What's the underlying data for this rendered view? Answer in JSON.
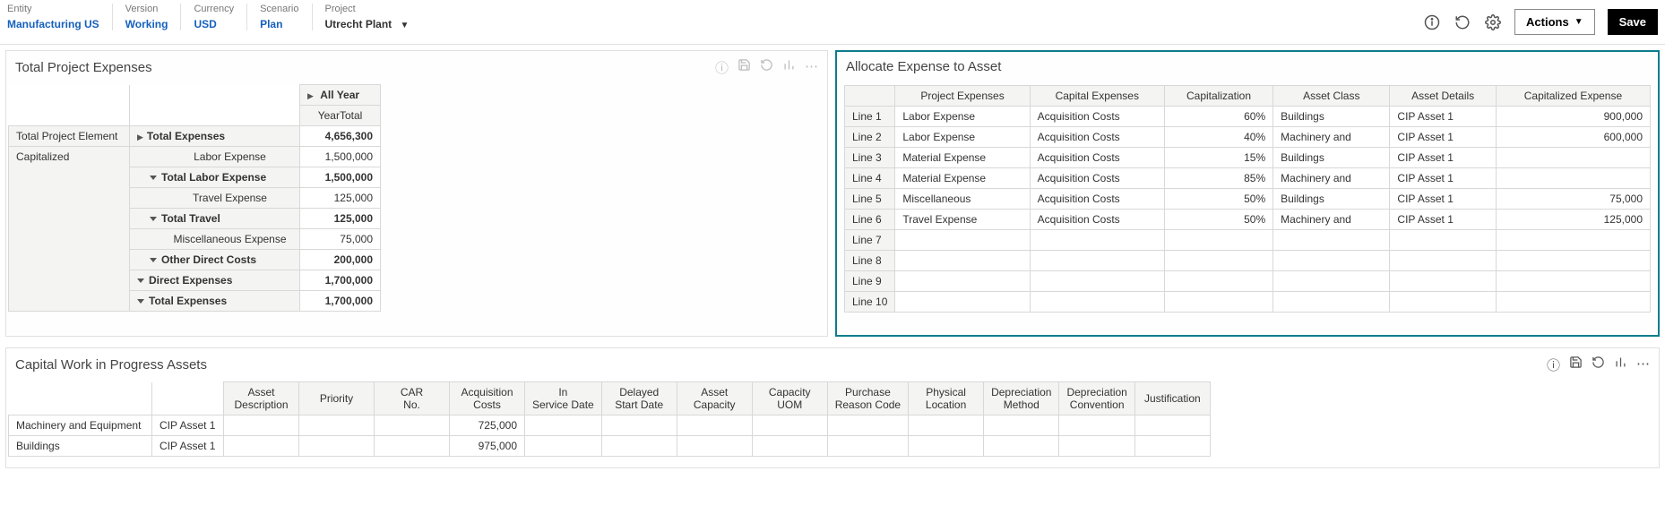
{
  "pov": {
    "items": [
      {
        "label": "Entity",
        "value": "Manufacturing US",
        "link": true
      },
      {
        "label": "Version",
        "value": "Working",
        "link": true
      },
      {
        "label": "Currency",
        "value": "USD",
        "link": true
      },
      {
        "label": "Scenario",
        "value": "Plan",
        "link": true
      },
      {
        "label": "Project",
        "value": "Utrecht Plant",
        "link": false,
        "dropdown": true
      }
    ],
    "actions_label": "Actions",
    "save_label": "Save"
  },
  "left_panel": {
    "title": "Total Project Expenses",
    "col_header_top": "All Year",
    "col_header_sub": "YearTotal",
    "row_header_1": "Total Project Element",
    "row_header_2": "Capitalized",
    "rows": [
      {
        "label": "Total Expenses",
        "value": "4,656,300",
        "bold": true,
        "tri": "r",
        "indent": 0
      },
      {
        "label": "Labor Expense",
        "value": "1,500,000",
        "bold": false,
        "tri": "",
        "indent": 2
      },
      {
        "label": "Total Labor Expense",
        "value": "1,500,000",
        "bold": true,
        "tri": "d",
        "indent": 1
      },
      {
        "label": "Travel Expense",
        "value": "125,000",
        "bold": false,
        "tri": "",
        "indent": 2
      },
      {
        "label": "Total Travel",
        "value": "125,000",
        "bold": true,
        "tri": "d",
        "indent": 1
      },
      {
        "label": "Miscellaneous Expense",
        "value": "75,000",
        "bold": false,
        "tri": "",
        "indent": 2
      },
      {
        "label": "Other Direct Costs",
        "value": "200,000",
        "bold": true,
        "tri": "d",
        "indent": 1
      },
      {
        "label": "Direct Expenses",
        "value": "1,700,000",
        "bold": true,
        "tri": "d",
        "indent": 0
      },
      {
        "label": "Total Expenses",
        "value": "1,700,000",
        "bold": true,
        "tri": "d",
        "indent": 0
      }
    ]
  },
  "right_panel": {
    "title": "Allocate Expense to Asset",
    "columns": [
      "Project Expenses",
      "Capital Expenses",
      "Capitalization",
      "Asset Class",
      "Asset Details",
      "Capitalized Expense"
    ],
    "row_labels": [
      "Line 1",
      "Line 2",
      "Line 3",
      "Line 4",
      "Line 5",
      "Line 6",
      "Line 7",
      "Line 8",
      "Line 9",
      "Line 10"
    ],
    "rows": [
      {
        "pe": "Labor Expense",
        "ce": "Acquisition Costs",
        "cap": "60%",
        "ac": "Buildings",
        "ad": "CIP Asset 1",
        "amt": "900,000"
      },
      {
        "pe": "Labor Expense",
        "ce": "Acquisition Costs",
        "cap": "40%",
        "ac": "Machinery and",
        "ad": "CIP Asset 1",
        "amt": "600,000"
      },
      {
        "pe": "Material Expense",
        "ce": "Acquisition Costs",
        "cap": "15%",
        "ac": "Buildings",
        "ad": "CIP Asset 1",
        "amt": ""
      },
      {
        "pe": "Material Expense",
        "ce": "Acquisition Costs",
        "cap": "85%",
        "ac": "Machinery and",
        "ad": "CIP Asset 1",
        "amt": ""
      },
      {
        "pe": "Miscellaneous",
        "ce": "Acquisition Costs",
        "cap": "50%",
        "ac": "Buildings",
        "ad": "CIP Asset 1",
        "amt": "75,000"
      },
      {
        "pe": "Travel Expense",
        "ce": "Acquisition Costs",
        "cap": "50%",
        "ac": "Machinery and",
        "ad": "CIP Asset 1",
        "amt": "125,000"
      },
      {
        "pe": "",
        "ce": "",
        "cap": "",
        "ac": "",
        "ad": "",
        "amt": ""
      },
      {
        "pe": "",
        "ce": "",
        "cap": "",
        "ac": "",
        "ad": "",
        "amt": ""
      },
      {
        "pe": "",
        "ce": "",
        "cap": "",
        "ac": "",
        "ad": "",
        "amt": ""
      },
      {
        "pe": "",
        "ce": "",
        "cap": "",
        "ac": "",
        "ad": "",
        "amt": ""
      }
    ]
  },
  "cwip_panel": {
    "title": "Capital Work in Progress Assets",
    "columns": [
      "Asset Description",
      "Priority",
      "CAR No.",
      "Acquisition Costs",
      "In Service Date",
      "Delayed Start Date",
      "Asset Capacity",
      "Capacity UOM",
      "Purchase Reason Code",
      "Physical Location",
      "Depreciation Method",
      "Depreciation Convention",
      "Justification"
    ],
    "rows": [
      {
        "h1": "Machinery and Equipment",
        "h2": "CIP Asset 1",
        "acq": "725,000"
      },
      {
        "h1": "Buildings",
        "h2": "CIP Asset 1",
        "acq": "975,000"
      }
    ]
  }
}
